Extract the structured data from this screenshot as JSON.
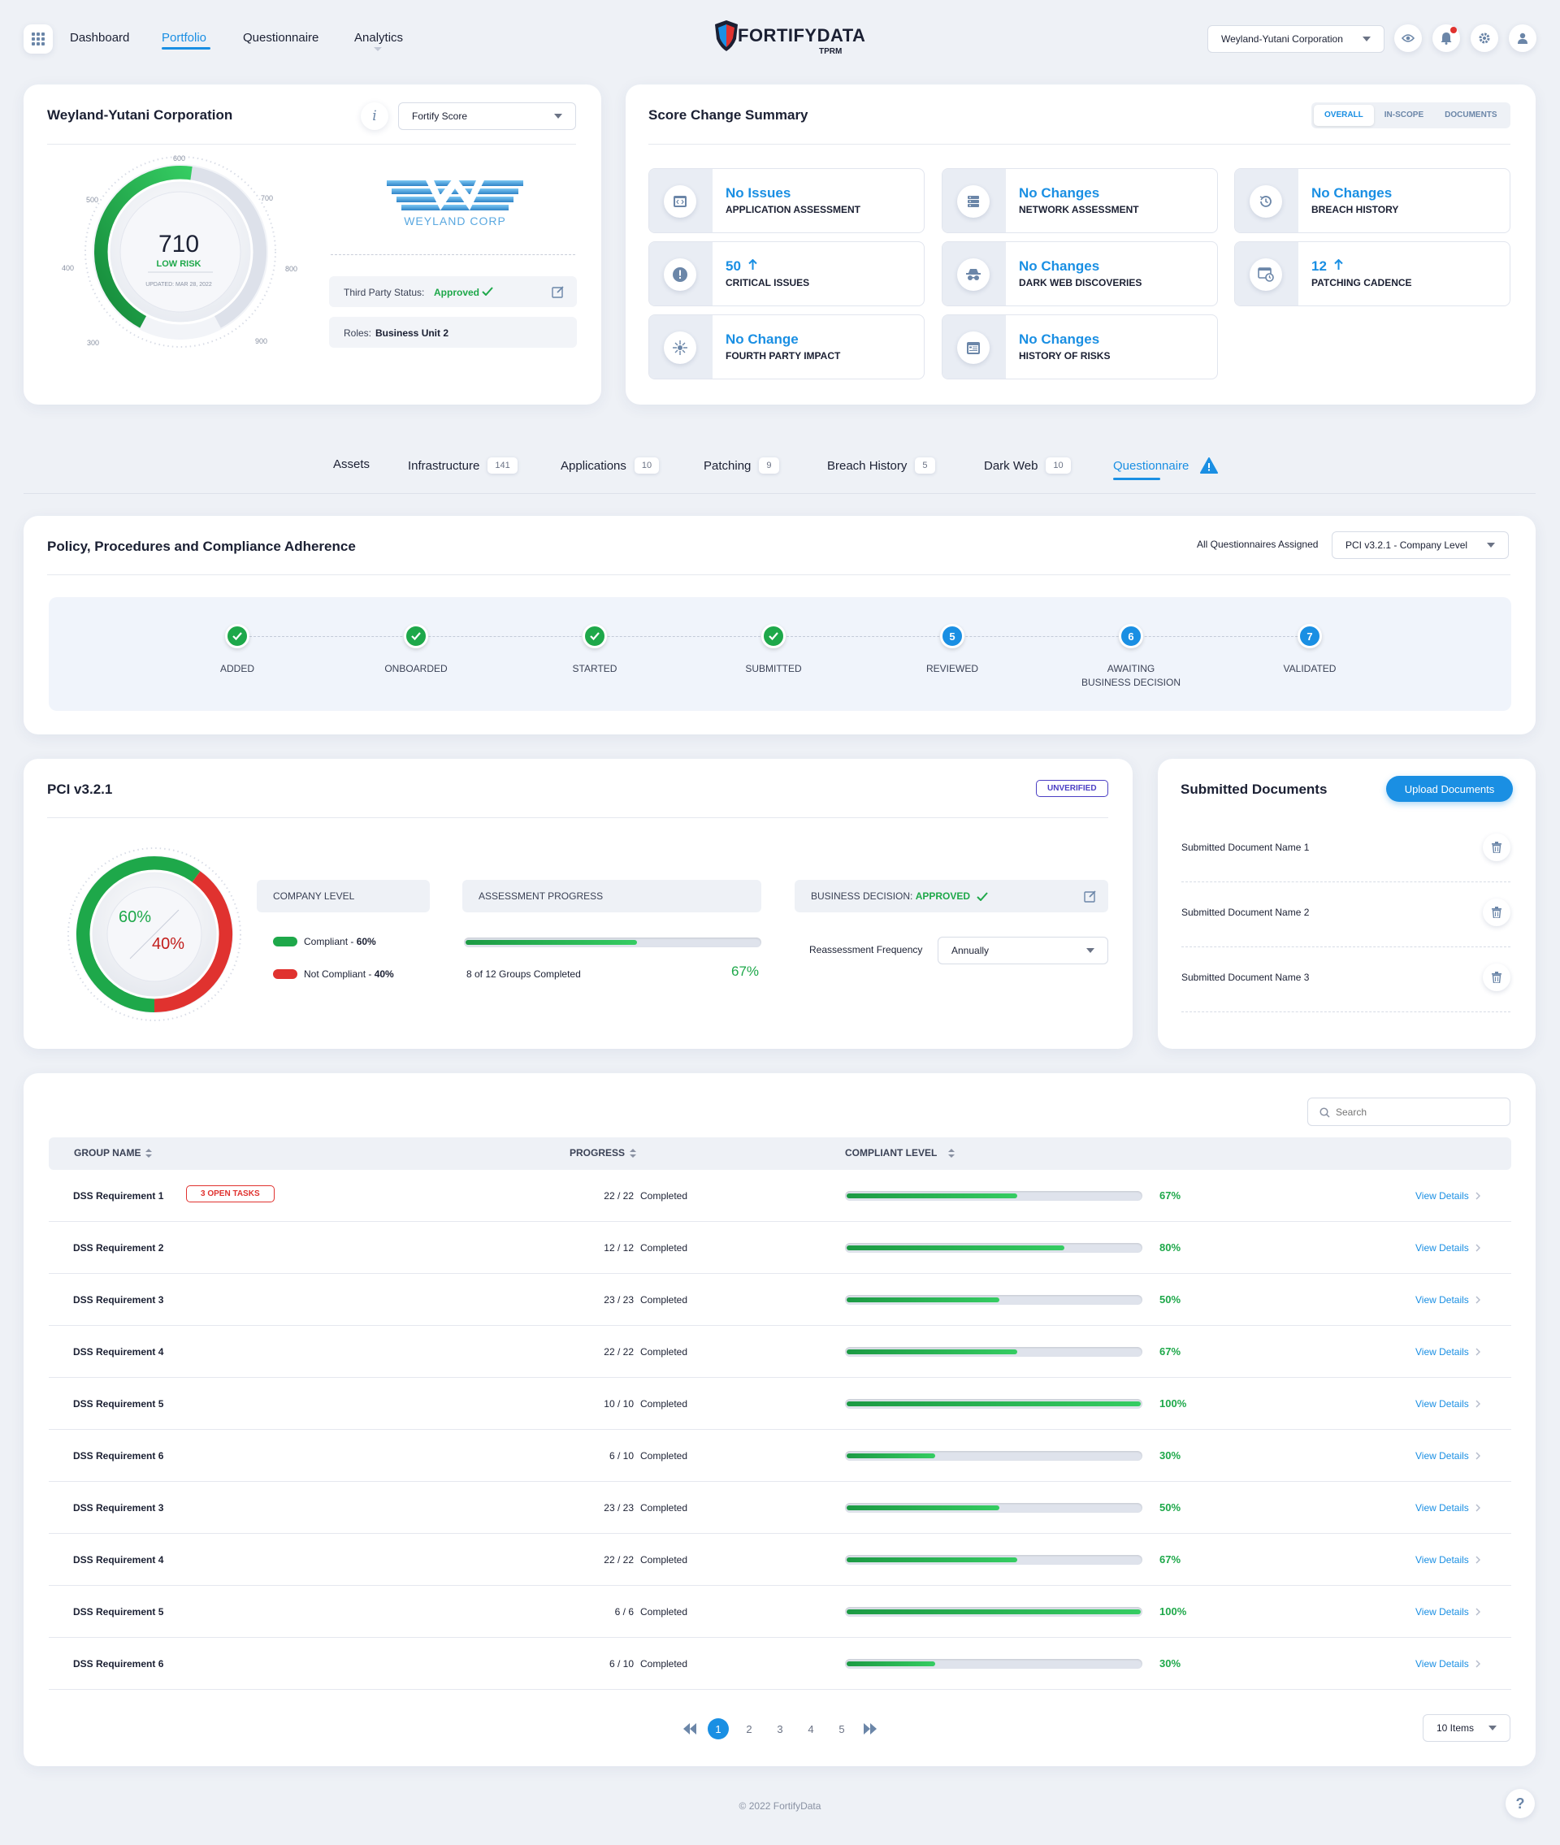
{
  "nav": {
    "items": [
      {
        "label": "Dashboard"
      },
      {
        "label": "Portfolio"
      },
      {
        "label": "Questionnaire"
      },
      {
        "label": "Analytics"
      }
    ],
    "brand": "FORTIFYDATA",
    "brand_sub": "TPRM",
    "org_select": "Weyland-Yutani Corporation"
  },
  "company": {
    "name": "Weyland-Yutani Corporation",
    "score_select": "Fortify Score",
    "score": "710",
    "risk": "LOW RISK",
    "updated": "UPDATED: MAR 28, 2022",
    "gauge_min_marks": [
      "300",
      "400",
      "500",
      "600",
      "700",
      "800",
      "900"
    ],
    "logo_text": "WEYLAND CORP",
    "status_label": "Third Party Status:",
    "status_value": "Approved",
    "roles_label": "Roles:",
    "roles_value": "Business Unit 2"
  },
  "summary": {
    "title": "Score Change Summary",
    "segments": [
      "OVERALL",
      "IN-SCOPE",
      "DOCUMENTS"
    ],
    "cards": [
      {
        "value": "No Issues",
        "label": "APPLICATION ASSESSMENT",
        "icon": "code-window-icon"
      },
      {
        "value": "No Changes",
        "label": "NETWORK ASSESSMENT",
        "icon": "server-icon"
      },
      {
        "value": "No Changes",
        "label": "BREACH HISTORY",
        "icon": "history-icon"
      },
      {
        "value": "50",
        "label": "CRITICAL ISSUES",
        "icon": "alert-icon",
        "arrow": true
      },
      {
        "value": "No Changes",
        "label": "DARK WEB DISCOVERIES",
        "icon": "spy-icon"
      },
      {
        "value": "12",
        "label": "PATCHING CADENCE",
        "icon": "patch-icon",
        "arrow": true
      },
      {
        "value": "No Change",
        "label": "FOURTH PARTY IMPACT",
        "icon": "network-icon"
      },
      {
        "value": "No Changes",
        "label": "HISTORY OF RISKS",
        "icon": "calendar-icon"
      }
    ]
  },
  "tabs": [
    {
      "label": "Assets",
      "count": ""
    },
    {
      "label": "Infrastructure",
      "count": "141"
    },
    {
      "label": "Applications",
      "count": "10"
    },
    {
      "label": "Patching",
      "count": "9"
    },
    {
      "label": "Breach History",
      "count": "5"
    },
    {
      "label": "Dark Web",
      "count": "10"
    },
    {
      "label": "Questionnaire",
      "count": ""
    }
  ],
  "policy": {
    "title": "Policy, Procedures and Compliance Adherence",
    "assigned_label": "All Questionnaires Assigned",
    "select": "PCI v3.2.1 - Company Level",
    "steps": [
      {
        "label": "ADDED",
        "state": "done",
        "n": ""
      },
      {
        "label": "ONBOARDED",
        "state": "done",
        "n": ""
      },
      {
        "label": "STARTED",
        "state": "done",
        "n": ""
      },
      {
        "label": "SUBMITTED",
        "state": "done",
        "n": ""
      },
      {
        "label": "REVIEWED",
        "state": "num",
        "n": "5"
      },
      {
        "label": "AWAITING",
        "label2": "BUSINESS DECISION",
        "state": "num",
        "n": "6"
      },
      {
        "label": "VALIDATED",
        "state": "num",
        "n": "7"
      }
    ]
  },
  "pci": {
    "title": "PCI v3.2.1",
    "status": "UNVERIFIED",
    "compliant_pct": "60%",
    "noncompliant_pct": "40%",
    "compliant_fraction": 0.6,
    "company_level": "COMPANY LEVEL",
    "compliant_label": "Compliant - ",
    "compliant_val": "60%",
    "noncompliant_label": "Not Compliant - ",
    "noncompliant_val": "40%",
    "assessment_label": "ASSESSMENT PROGRESS",
    "assessment_text": "8 of 12 Groups Completed",
    "assessment_pct": "67%",
    "assessment_fraction": 0.583,
    "decision_label": "BUSINESS DECISION:",
    "decision_value": "APPROVED",
    "reassess_label": "Reassessment Frequency",
    "reassess_value": "Annually"
  },
  "docs": {
    "title": "Submitted Documents",
    "upload": "Upload Documents",
    "items": [
      "Submitted Document Name 1",
      "Submitted Document Name 2",
      "Submitted Document Name 3"
    ]
  },
  "table": {
    "search_placeholder": "Search",
    "headers": [
      "GROUP NAME",
      "PROGRESS",
      "COMPLIANT LEVEL"
    ],
    "view": "View Details",
    "rows": [
      {
        "name": "DSS Requirement 1",
        "tag": "3 OPEN TASKS",
        "progress": "22 / 22",
        "status": "Completed",
        "level": 0.58,
        "pct": "67%"
      },
      {
        "name": "DSS Requirement 2",
        "tag": "",
        "progress": "12 / 12",
        "status": "Completed",
        "level": 0.74,
        "pct": "80%"
      },
      {
        "name": "DSS Requirement 3",
        "tag": "",
        "progress": "23 / 23",
        "status": "Completed",
        "level": 0.52,
        "pct": "50%"
      },
      {
        "name": "DSS Requirement 4",
        "tag": "",
        "progress": "22 / 22",
        "status": "Completed",
        "level": 0.58,
        "pct": "67%"
      },
      {
        "name": "DSS Requirement 5",
        "tag": "",
        "progress": "10 / 10",
        "status": "Completed",
        "level": 1.0,
        "pct": "100%"
      },
      {
        "name": "DSS Requirement 6",
        "tag": "",
        "progress": "6 / 10",
        "status": "Completed",
        "level": 0.3,
        "pct": "30%"
      },
      {
        "name": "DSS Requirement 3",
        "tag": "",
        "progress": "23 / 23",
        "status": "Completed",
        "level": 0.52,
        "pct": "50%"
      },
      {
        "name": "DSS Requirement 4",
        "tag": "",
        "progress": "22 / 22",
        "status": "Completed",
        "level": 0.58,
        "pct": "67%"
      },
      {
        "name": "DSS Requirement 5",
        "tag": "",
        "progress": "6 / 6",
        "status": "Completed",
        "level": 1.0,
        "pct": "100%"
      },
      {
        "name": "DSS Requirement 6",
        "tag": "",
        "progress": "6 / 10",
        "status": "Completed",
        "level": 0.3,
        "pct": "30%"
      }
    ],
    "pages": [
      "1",
      "2",
      "3",
      "4",
      "5"
    ],
    "per_page": "10 Items"
  },
  "footer": {
    "copy": "© 2022 FortifyData",
    "help": "?"
  },
  "colors": {
    "accent": "#1a8fe3",
    "success": "#1ea84a",
    "danger": "#e0322f"
  }
}
